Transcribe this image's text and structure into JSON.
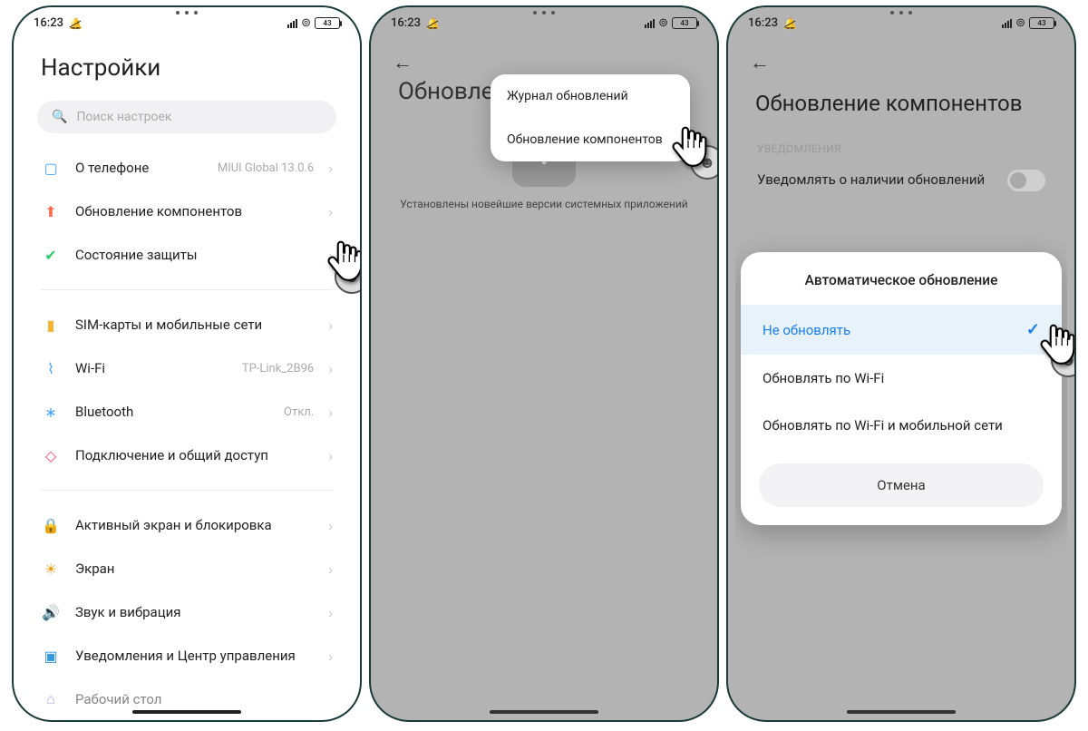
{
  "status": {
    "time": "16:23",
    "battery": "43"
  },
  "screen1": {
    "title": "Настройки",
    "search_placeholder": "Поиск настроек",
    "items": [
      {
        "label": "О телефоне",
        "value": "MIUI Global 13.0.6",
        "icon": "phone-icon",
        "color": "#4aa3ff"
      },
      {
        "label": "Обновление компонентов",
        "value": "",
        "icon": "arrow-up-icon",
        "color": "#ff6b4a"
      },
      {
        "label": "Состояние защиты",
        "value": "",
        "icon": "shield-icon",
        "color": "#2ecc71"
      }
    ],
    "group2": [
      {
        "label": "SIM-карты и мобильные сети",
        "icon": "sim-icon",
        "color": "#f7b42c"
      },
      {
        "label": "Wi-Fi",
        "value": "TP-Link_2B96",
        "icon": "wifi-icon",
        "color": "#4aa3ff"
      },
      {
        "label": "Bluetooth",
        "value": "Откл.",
        "icon": "bluetooth-icon",
        "color": "#4aa3ff"
      },
      {
        "label": "Подключение и общий доступ",
        "icon": "share-icon",
        "color": "#ff4a6b"
      }
    ],
    "group3": [
      {
        "label": "Активный экран и блокировка",
        "icon": "lock-icon",
        "color": "#e74c3c"
      },
      {
        "label": "Экран",
        "icon": "sun-icon",
        "color": "#f39c12"
      },
      {
        "label": "Звук и вибрация",
        "icon": "sound-icon",
        "color": "#1abc9c"
      },
      {
        "label": "Уведомления и Центр управления",
        "icon": "bell-icon",
        "color": "#3498db"
      },
      {
        "label": "Рабочий стол",
        "icon": "home-icon",
        "color": "#5b6bff"
      }
    ]
  },
  "screen2": {
    "title": "Обновлен",
    "message": "Установлены новейшие версии системных приложений",
    "menu": [
      "Журнал обновлений",
      "Обновление компонентов"
    ]
  },
  "screen3": {
    "title": "Обновление компонентов",
    "section": "УВЕДОМЛЕНИЯ",
    "toggle_label": "Уведомлять о наличии обновлений",
    "sheet_title": "Автоматическое обновление",
    "options": [
      "Не обновлять",
      "Обновлять по Wi-Fi",
      "Обновлять по Wi-Fi и мобильной сети"
    ],
    "cancel": "Отмена"
  }
}
